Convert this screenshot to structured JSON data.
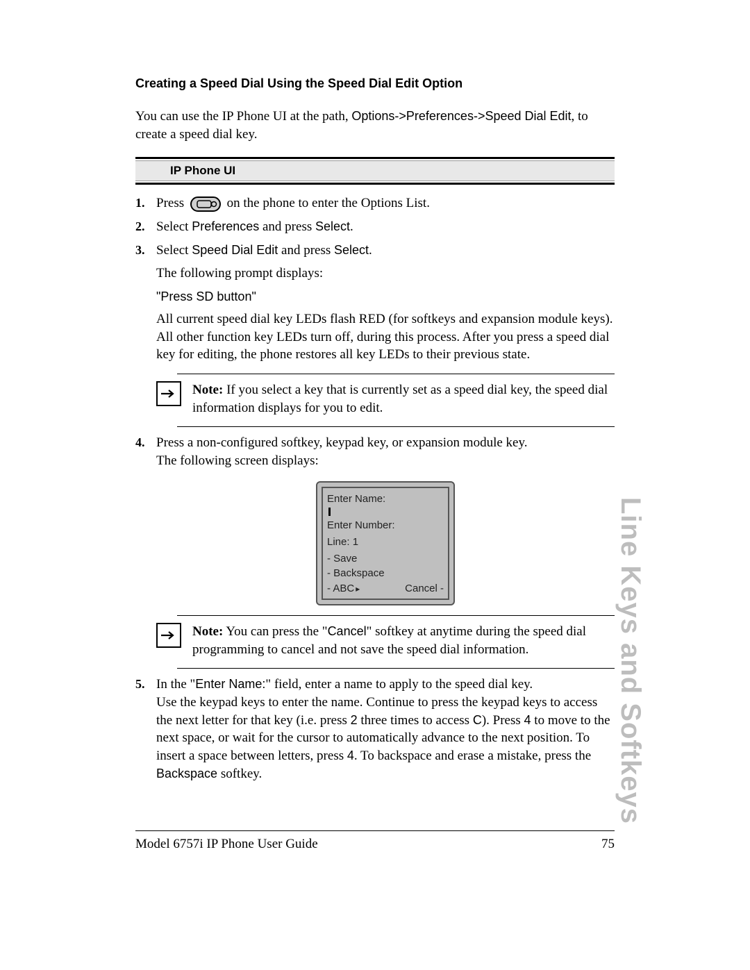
{
  "heading": "Creating a Speed Dial Using the Speed Dial Edit Option",
  "intro_pre": "You can use the IP Phone UI at the path, ",
  "intro_path": "Options->Preferences->Speed Dial Edit",
  "intro_post": ", to create a speed dial key.",
  "ui_bar": "IP Phone UI",
  "steps": {
    "s1_a": "Press ",
    "s1_b": " on the phone to enter the Options List.",
    "s2_a": "Select ",
    "s2_b": "Preferences",
    "s2_c": " and press ",
    "s2_d": "Select",
    "s2_e": ".",
    "s3_a": "Select ",
    "s3_b": "Speed Dial Edit",
    "s3_c": " and press ",
    "s3_d": "Select",
    "s3_e": ".",
    "s3_p1": "The following prompt displays:",
    "s3_p2": "\"Press SD button\"",
    "s3_p3": "All current speed dial key LEDs flash RED (for softkeys and expansion module keys). All other function key LEDs turn off, during this process. After you press a speed dial key for editing, the phone restores all key LEDs to their previous state.",
    "s4_a": "Press a non-configured softkey, keypad key, or expansion module key.",
    "s4_b": "The following screen displays:",
    "s5_a": "In the \"",
    "s5_b": "Enter Name:",
    "s5_c": "\" field, enter a name to apply to the speed dial key.",
    "s5_d": "Use the keypad keys to enter the name. Continue to press the keypad keys to access the next letter for that key (i.e. press ",
    "s5_2": "2",
    "s5_e": " three times to access ",
    "s5_C": "C",
    "s5_f": "). Press ",
    "s5_4a": "4",
    "s5_g": " to move to the next space, or wait for the cursor to automatically advance to the next position. To insert a space between letters, press ",
    "s5_4b": "4",
    "s5_h": ". To backspace and erase a mistake, press the ",
    "s5_bs": "Backspace",
    "s5_i": " softkey."
  },
  "note1_label": "Note:",
  "note1": " If you select a key that is currently set as a speed dial key, the speed dial information displays for you to edit.",
  "note2_label": "Note:",
  "note2_a": " You can press the \"",
  "note2_cancel": "Cancel",
  "note2_b": "\" softkey at anytime during the speed dial programming to cancel and not save the speed dial information.",
  "phone": {
    "enter_name": "Enter Name:",
    "enter_number": "Enter Number:",
    "line": "Line: 1",
    "save": "- Save",
    "backspace": "- Backspace",
    "abc": "- ABC",
    "cancel": "Cancel -"
  },
  "footer_left": "Model 6757i IP Phone User Guide",
  "footer_right": "75",
  "side_tab": "Line Keys and Softkeys"
}
